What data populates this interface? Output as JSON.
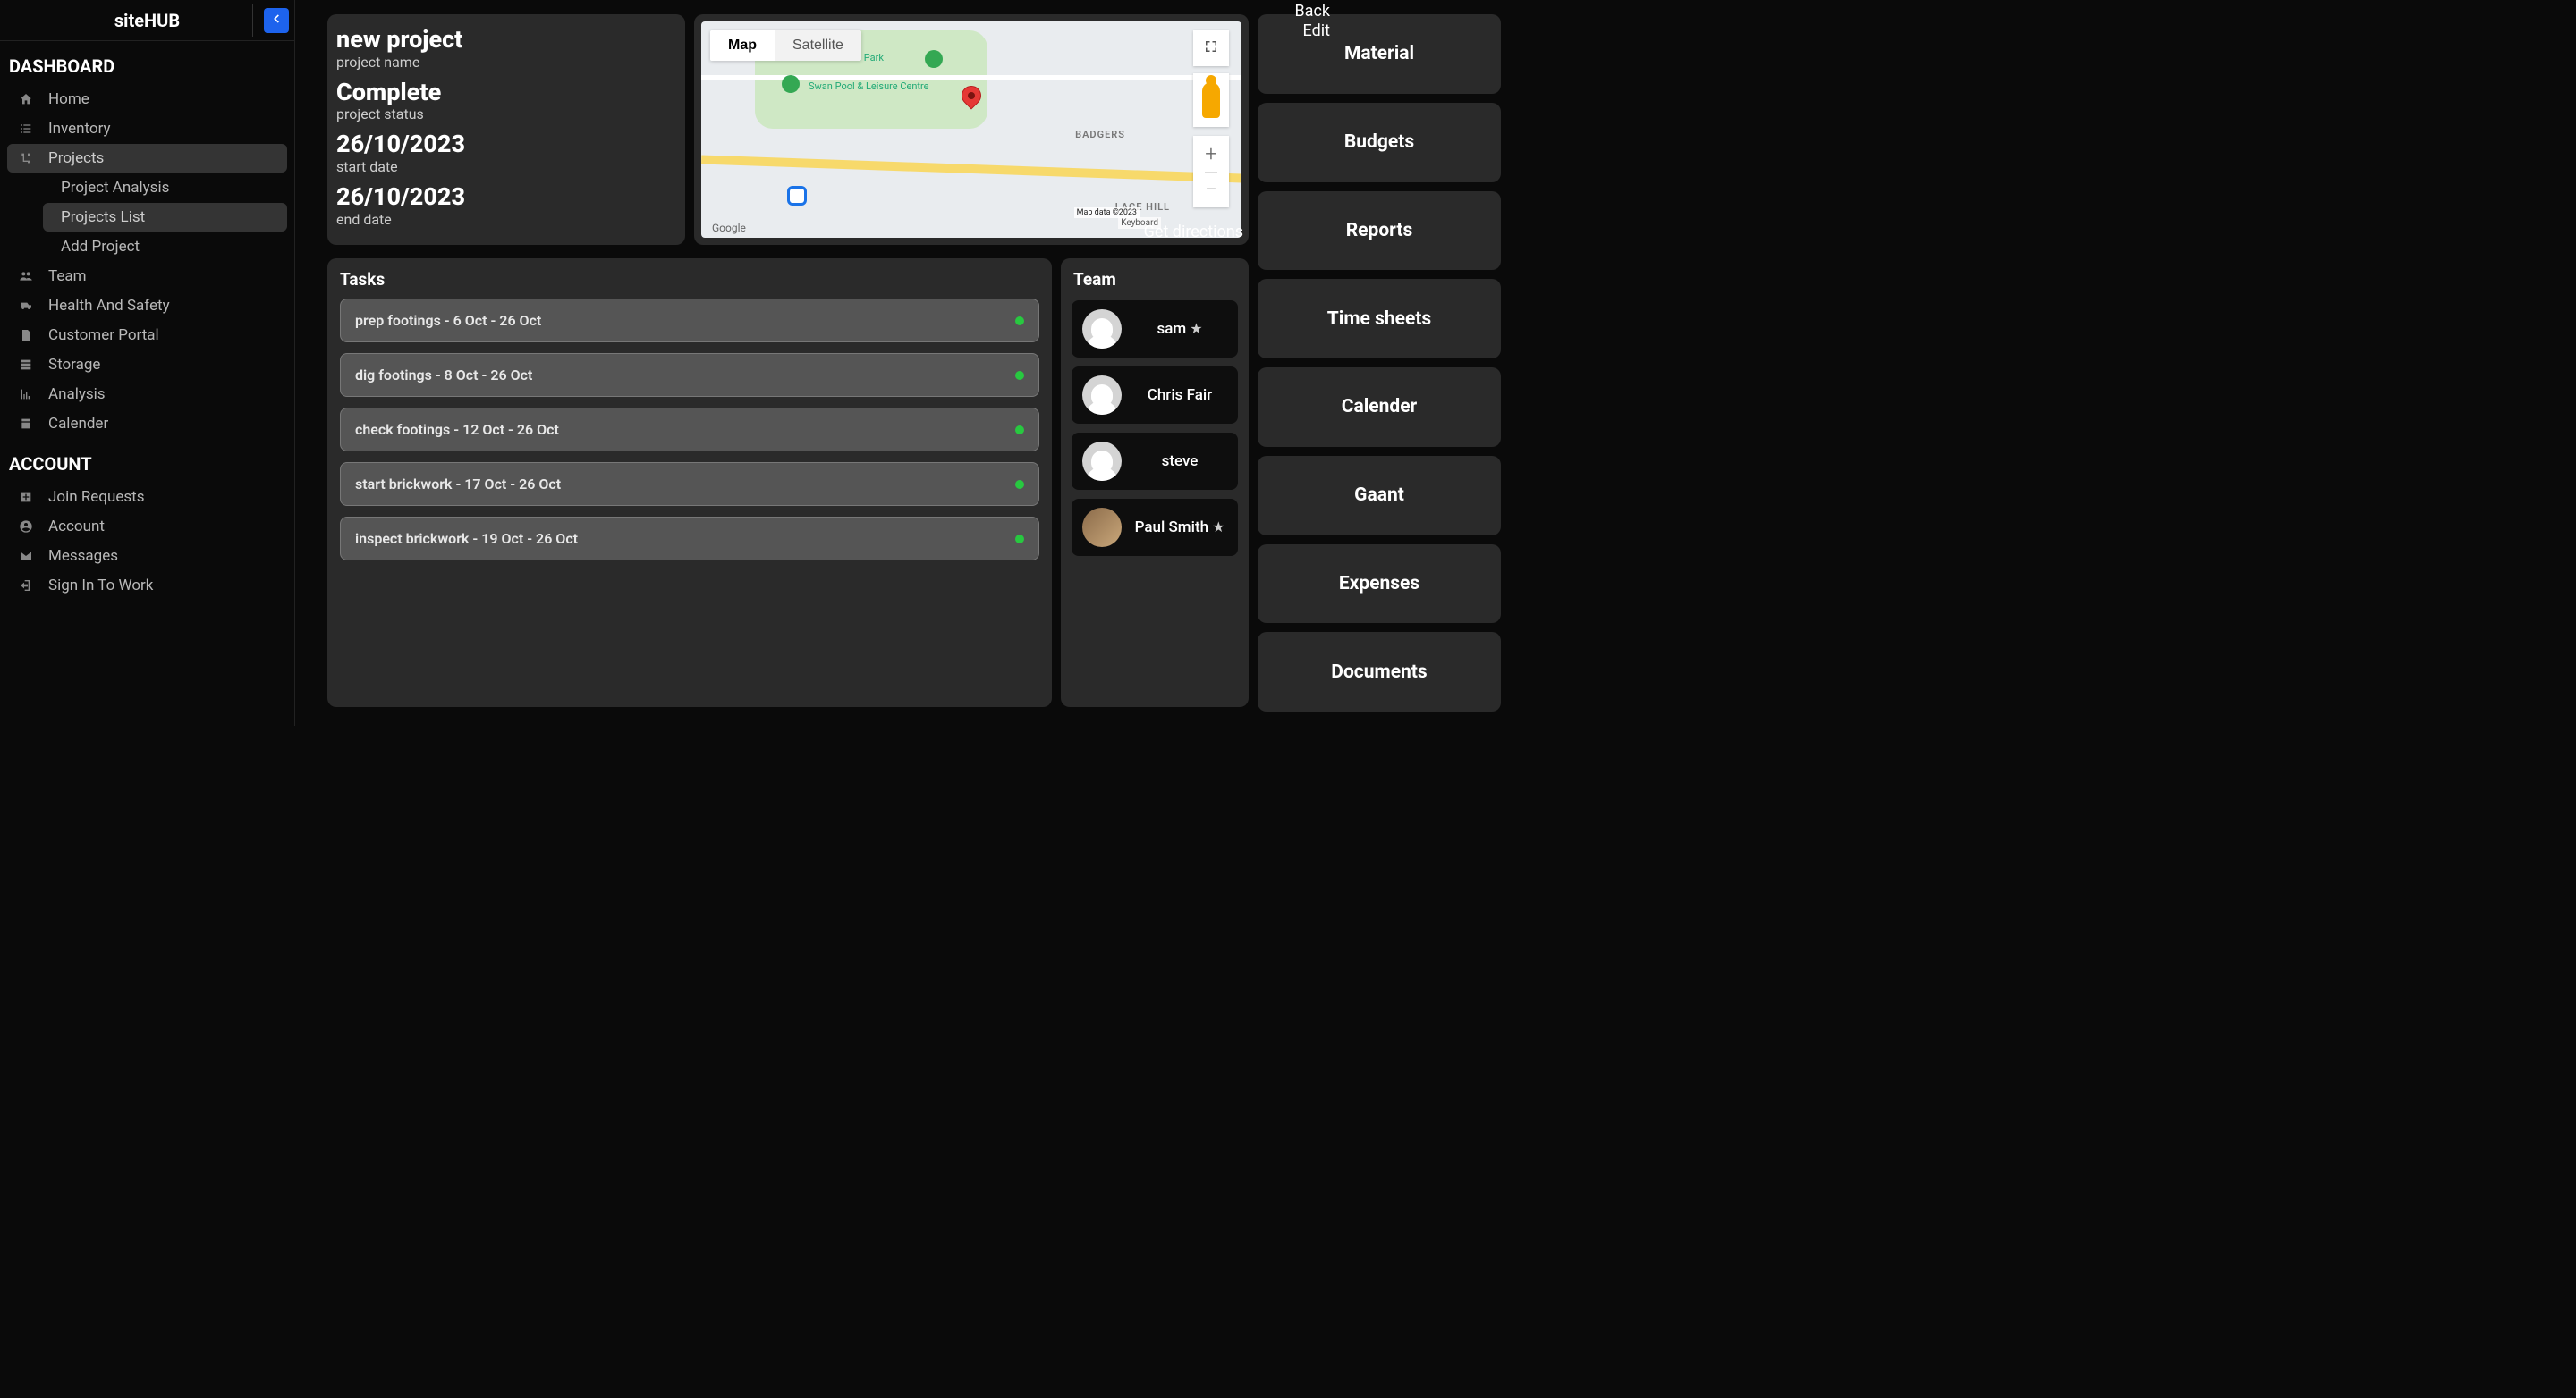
{
  "brand": "siteHUB",
  "top_actions": {
    "back": "Back",
    "edit": "Edit"
  },
  "sections": {
    "dashboard": "DASHBOARD",
    "account": "ACCOUNT"
  },
  "nav": {
    "home": "Home",
    "inventory": "Inventory",
    "projects": "Projects",
    "projects_sub": {
      "analysis": "Project Analysis",
      "list": "Projects List",
      "add": "Add Project"
    },
    "team": "Team",
    "health_safety": "Health And Safety",
    "customer_portal": "Customer Portal",
    "storage": "Storage",
    "analysis": "Analysis",
    "calender": "Calender"
  },
  "account_nav": {
    "join_requests": "Join Requests",
    "account": "Account",
    "messages": "Messages",
    "sign_in": "Sign In To Work"
  },
  "project": {
    "name": "new project",
    "name_label": "project name",
    "status": "Complete",
    "status_label": "project status",
    "start": "26/10/2023",
    "start_label": "start date",
    "end": "26/10/2023",
    "end_label": "end date"
  },
  "map": {
    "type_map": "Map",
    "type_satellite": "Satellite",
    "directions": "Get directions",
    "badgers": "BADGERS",
    "lacehill": "LACE HILL",
    "bourton": "Bourton Park",
    "swan": "Swan Pool & Leisure Centre",
    "keyboard": "Keyboard",
    "attr": "Map data ©2023",
    "google": "Google",
    "zoom_in": "+",
    "zoom_out": "−"
  },
  "tasks_title": "Tasks",
  "tasks": [
    "prep footings - 6 Oct - 26 Oct",
    "dig footings - 8 Oct - 26 Oct",
    "check footings - 12 Oct - 26 Oct",
    "start brickwork - 17 Oct - 26 Oct",
    "inspect brickwork - 19 Oct - 26 Oct"
  ],
  "team_title": "Team",
  "team": [
    {
      "name": "sam",
      "star": true,
      "photo": false
    },
    {
      "name": "Chris Fair",
      "star": false,
      "photo": false
    },
    {
      "name": "steve",
      "star": false,
      "photo": false
    },
    {
      "name": "Paul Smith",
      "star": true,
      "photo": true
    }
  ],
  "actions": {
    "material": "Material",
    "budgets": "Budgets",
    "reports": "Reports",
    "timesheets": "Time sheets",
    "calender": "Calender",
    "gaant": "Gaant",
    "expenses": "Expenses",
    "documents": "Documents"
  }
}
